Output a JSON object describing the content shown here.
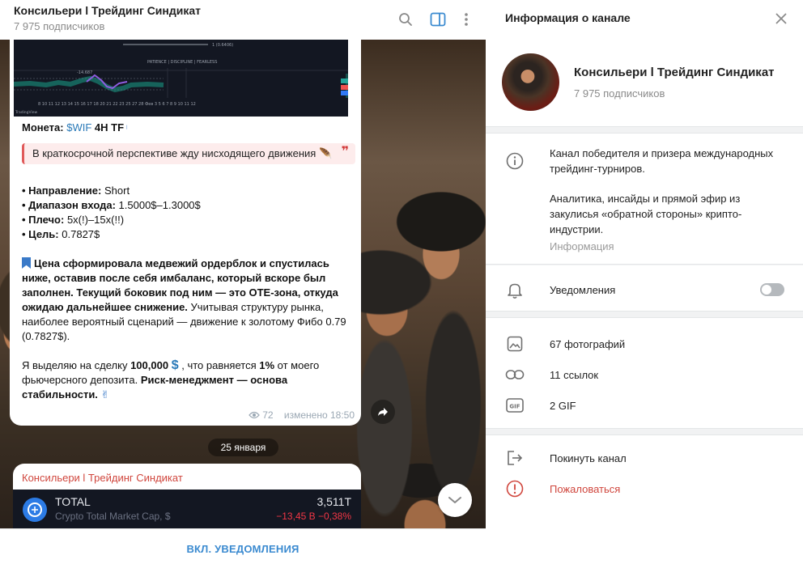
{
  "chat": {
    "title": "Консильери l Трейдинг Синдикат",
    "subscribers": "7 975 подписчиков"
  },
  "post": {
    "coin_label": "Монета:",
    "coin_ticker": "$WIF",
    "coin_tf": "4H TF",
    "quote": "В краткосрочной перспективе жду нисходящего движения",
    "quote_mark": "❞",
    "direction_label": "• Направление:",
    "direction_value": "Short",
    "entry_label": "• Диапазон входа:",
    "entry_value": "1.5000$–1.3000$",
    "leverage_label": "• Плечо:",
    "leverage_value": "5x(!)–15x(!!)",
    "target_label": "• Цель:",
    "target_value": "0.7827$",
    "analysis_bold": "Цена сформировала медвежий ордерблок и спустилась ниже, оставив после себя имбаланс, который вскоре был заполнен. Текущий боковик под ним — это OTE-зона, откуда ожидаю дальнейшее снижение.",
    "analysis_plain": "Учитывая структуру рынка, наиболее вероятный сценарий — движение к золотому Фибо 0.79 (0.7827$).",
    "alloc_1": "Я выделяю на сделку",
    "alloc_amount": "100,000",
    "alloc_2": ", что равняется",
    "alloc_pct": "1%",
    "alloc_3": "от моего фьючерсного депозита.",
    "alloc_bold": "Риск-менеджмент — основа стабильности.",
    "views": "72",
    "edited": "изменено 18:50"
  },
  "date_pill": "25 января",
  "post2": {
    "author": "Консильери l Трейдинг Синдикат",
    "ticker_name": "TOTAL",
    "ticker_desc": "Crypto Total Market Cap, $",
    "ticker_value": "3,511T",
    "ticker_change": "−13,45 B  −0,38%"
  },
  "notify_button": "ВКЛ. УВЕДОМЛЕНИЯ",
  "info": {
    "title": "Информация о канале",
    "name": "Консильери l Трейдинг Синдикат",
    "subscribers": "7 975 подписчиков",
    "about_1": "Канал победителя и призера международных трейдинг-турниров.",
    "about_2": "Аналитика, инсайды и прямой эфир из закулисья «обратной стороны» крипто-индустрии.",
    "about_label": "Информация",
    "notifications": "Уведомления",
    "notifications_on": false,
    "photos": "67 фотографий",
    "links": "11 ссылок",
    "gifs": "2 GIF",
    "leave": "Покинуть канал",
    "report": "Пожаловаться"
  },
  "colors": {
    "accent": "#3a8ad0",
    "danger": "#d0463d",
    "muted": "#8a8a8a"
  }
}
